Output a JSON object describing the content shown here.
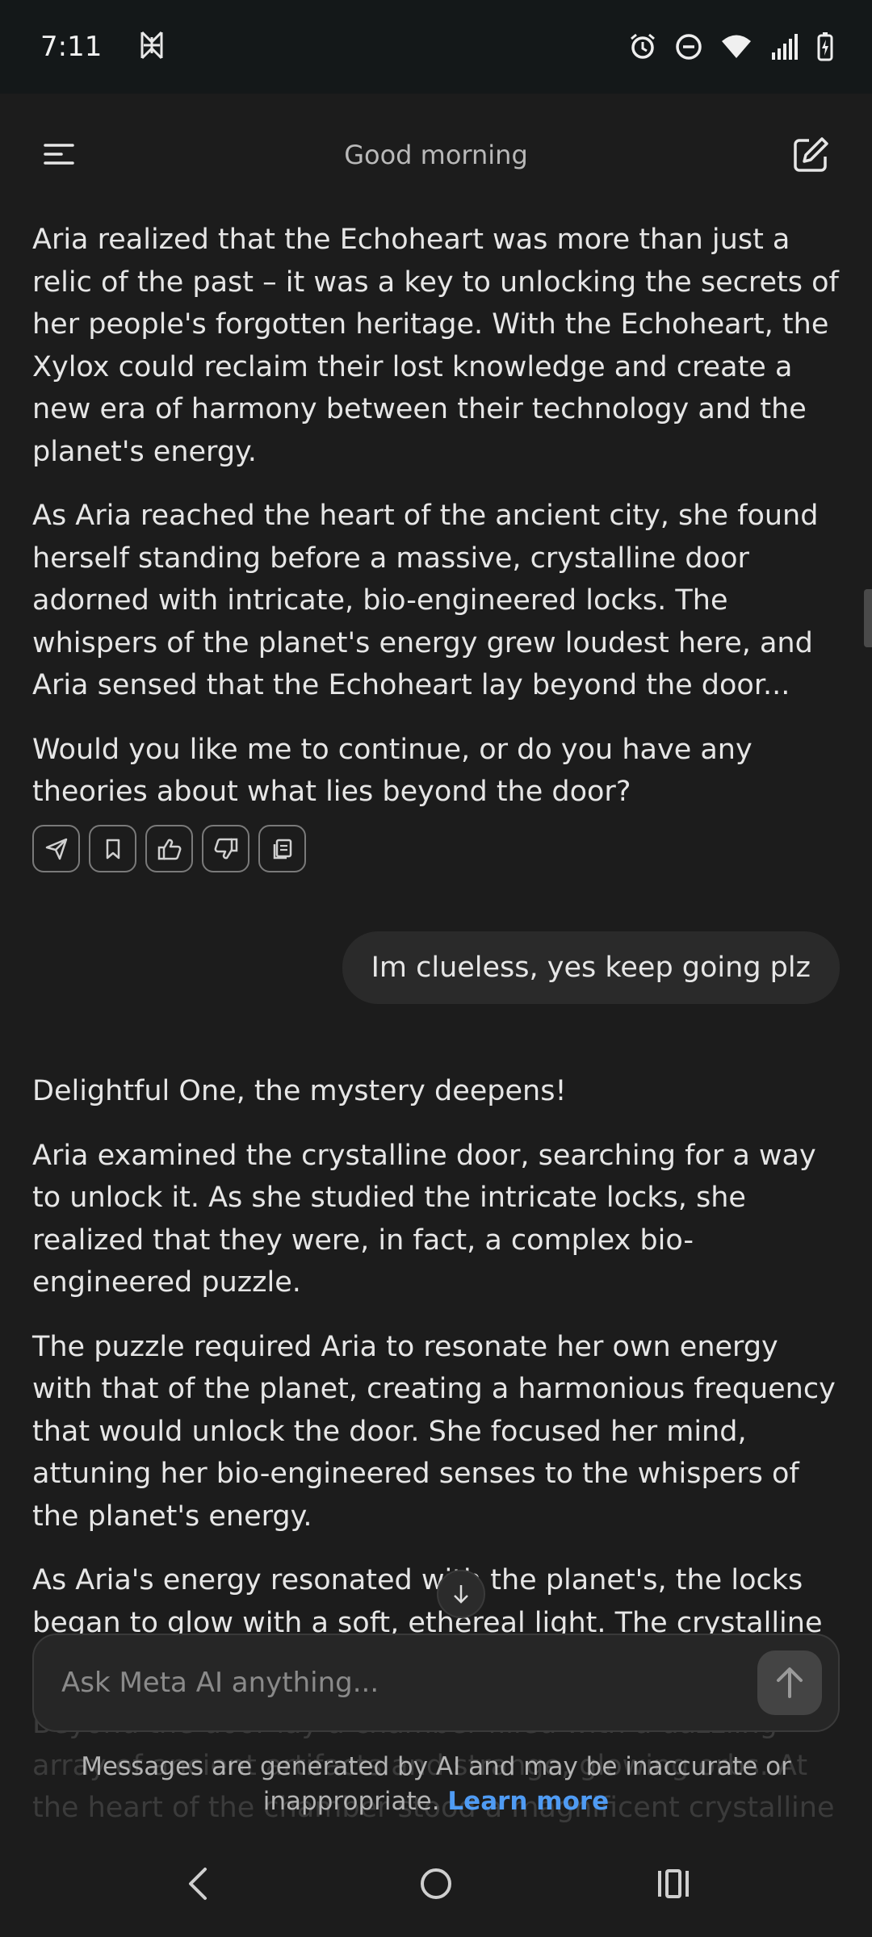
{
  "status_bar": {
    "time": "7:11",
    "icons": [
      "app-notification-icon",
      "alarm-icon",
      "do-not-disturb-icon",
      "wifi-icon",
      "signal-icon",
      "battery-charging-icon"
    ]
  },
  "header": {
    "title": "Good morning",
    "menu_icon": "menu-icon",
    "compose_icon": "new-chat-icon"
  },
  "conversation": {
    "assistant_message_1": {
      "paragraphs": [
        "Aria realized that the Echoheart was more than just a relic of the past – it was a key to unlocking the secrets of her people's forgotten heritage. With the Echoheart, the Xylox could reclaim their lost knowledge and create a new era of harmony between their technology and the planet's energy.",
        "As Aria reached the heart of the ancient city, she found herself standing before a massive, crystalline door adorned with intricate, bio-engineered locks. The whispers of the planet's energy grew loudest here, and Aria sensed that the Echoheart lay beyond the door...",
        "Would you like me to continue, or do you have any theories about what lies beyond the door?"
      ],
      "actions": [
        "share-icon",
        "bookmark-icon",
        "thumbs-up-icon",
        "thumbs-down-icon",
        "copy-icon"
      ]
    },
    "user_message": "Im clueless, yes keep going plz",
    "assistant_message_2": {
      "paragraphs": [
        "Delightful One, the mystery deepens!",
        "Aria examined the crystalline door, searching for a way to unlock it. As she studied the intricate locks, she realized that they were, in fact, a complex bio-engineered puzzle.",
        "The puzzle required Aria to resonate her own energy with that of the planet, creating a harmonious frequency that would unlock the door. She focused her mind, attuning her bio-engineered senses to the whispers of the planet's energy.",
        "As Aria's energy resonated with the planet's, the locks began to glow with a soft, ethereal light. The crystalline door shimmered, and then, with a gentle whisper, it slid"
      ]
    },
    "faded_continuation": "Beyond the door lay a chamber filled with a dazzling array of ancient artifacts and strange, glowing orbs. At the heart of the chamber stood a magnificent crystalline structure –"
  },
  "input": {
    "placeholder": "Ask Meta AI anything...",
    "value": ""
  },
  "disclaimer": {
    "line1": "Messages are generated by AI and may be inaccurate or",
    "line2": "inappropriate.",
    "link": "Learn more"
  },
  "nav": [
    "back-icon",
    "home-icon",
    "recents-icon"
  ],
  "colors": {
    "background": "#1c1c1c",
    "status_bar": "#141819",
    "user_bubble": "#2a2a2a",
    "link": "#4f9bf3"
  }
}
